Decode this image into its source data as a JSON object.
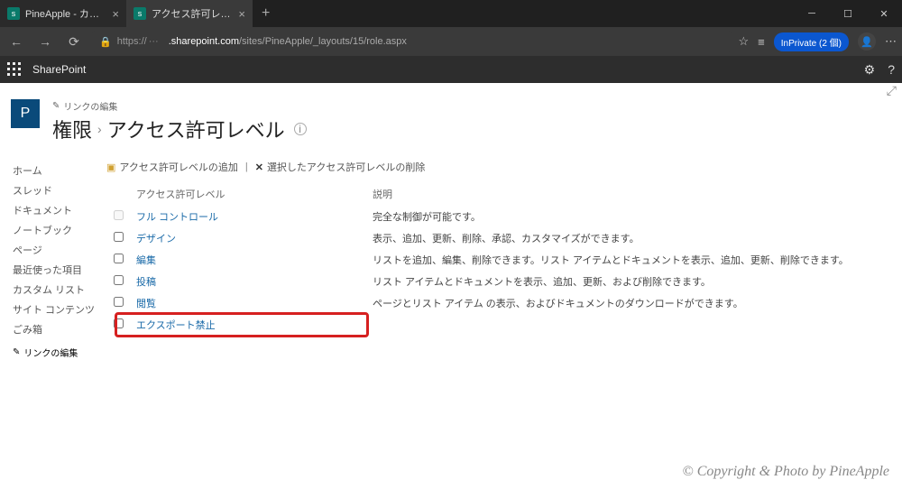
{
  "titlebar": {
    "tabs": [
      {
        "title": "PineApple - カスタム リスト - すべて",
        "active": false
      },
      {
        "title": "アクセス許可レベル",
        "active": true
      }
    ]
  },
  "addressbar": {
    "url_prefix": "https://",
    "url_host": ".sharepoint.com",
    "url_path": "/sites/PineApple/_layouts/15/role.aspx",
    "inprivate_label": "InPrivate (2 個)"
  },
  "suitebar": {
    "product": "SharePoint"
  },
  "header": {
    "site_initial": "P",
    "edit_links_label": "リンクの編集",
    "breadcrumb_root": "権限",
    "page_title": "アクセス許可レベル"
  },
  "leftnav": {
    "items": [
      "ホーム",
      "スレッド",
      "ドキュメント",
      "ノートブック",
      "ページ",
      "最近使った項目",
      "カスタム リスト",
      "サイト コンテンツ",
      "ごみ箱"
    ],
    "edit_links_label": "リンクの編集"
  },
  "toolbar": {
    "add_label": "アクセス許可レベルの追加",
    "delete_label": "選択したアクセス許可レベルの削除"
  },
  "table": {
    "col_name": "アクセス許可レベル",
    "col_desc": "説明",
    "rows": [
      {
        "name": "フル コントロール",
        "desc": "完全な制御が可能です。",
        "disabled": true
      },
      {
        "name": "デザイン",
        "desc": "表示、追加、更新、削除、承認、カスタマイズができます。",
        "disabled": false
      },
      {
        "name": "編集",
        "desc": "リストを追加、編集、削除できます。リスト アイテムとドキュメントを表示、追加、更新、削除できます。",
        "disabled": false
      },
      {
        "name": "投稿",
        "desc": "リスト アイテムとドキュメントを表示、追加、更新、および削除できます。",
        "disabled": false
      },
      {
        "name": "閲覧",
        "desc": "ページとリスト アイテム の表示、およびドキュメントのダウンロードができます。",
        "disabled": false
      },
      {
        "name": "エクスポート禁止",
        "desc": "",
        "disabled": false,
        "highlight": true
      }
    ]
  },
  "watermark": "© Copyright & Photo by PineApple"
}
